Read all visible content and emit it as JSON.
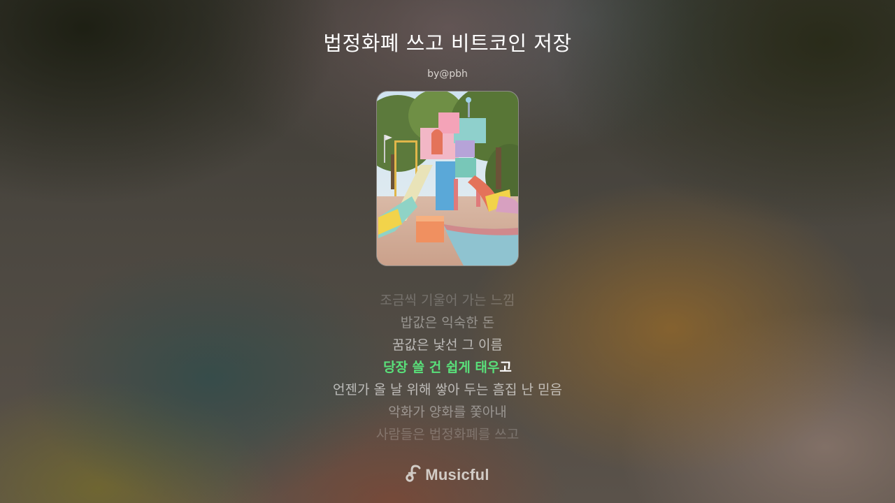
{
  "song": {
    "title": "법정화폐 쓰고 비트코인 저장",
    "author": "by@pbh",
    "cover_description_icon": "playground-cover-art"
  },
  "lyrics": {
    "line1": "조금씩 기울어 가는 느낌",
    "line2": "밥값은 익숙한 돈",
    "line3": "꿈값은 낯선 그 이름",
    "line4_sung": "당장 쓸 건 쉽게 태우",
    "line4_rest": "고",
    "line5": "언젠가 올 날 위해 쌓아 두는 흠집 난 믿음",
    "line6": "악화가 양화를 쫓아내",
    "line7": "사람들은 법정화폐를 쓰고"
  },
  "brand": {
    "name": "Musicful",
    "icon": "music-note-icon"
  },
  "colors": {
    "highlight": "#59e07a",
    "title": "#ffffff"
  }
}
